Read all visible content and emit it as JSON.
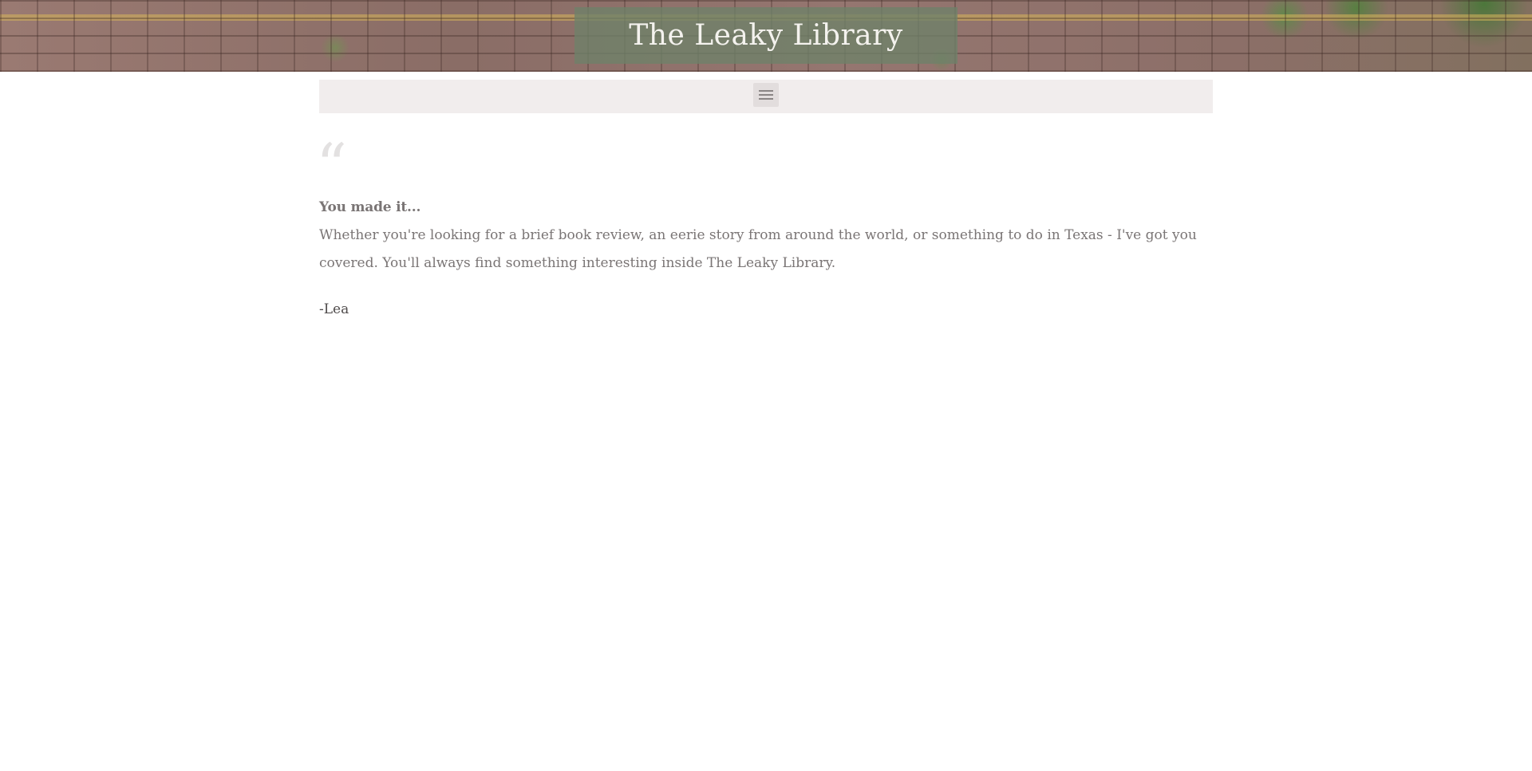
{
  "header": {
    "site_title": "The Leaky Library"
  },
  "nav": {
    "menu_icon": "hamburger-menu-icon"
  },
  "quote": {
    "mark": "“",
    "heading": "You made it...",
    "text": "Whether you're looking for a brief book review, an eerie story from around the world, or something to do in Texas - I've got you covered. You'll always find something interesting inside The Leaky Library.",
    "signature": "-Lea"
  },
  "colors": {
    "title_box": "#6e8269",
    "nav_bar": "#f1eded",
    "body_text": "#7a7575",
    "signature_text": "#4f4b4b",
    "quote_mark": "#e3e1e1"
  }
}
